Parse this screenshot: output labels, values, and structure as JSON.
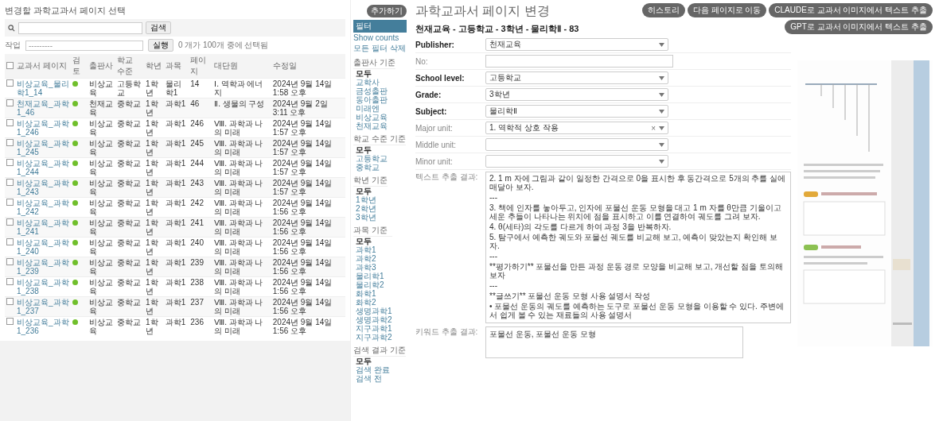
{
  "list_panel": {
    "title": "변경할 과학교과서 페이지 선택",
    "search": {
      "button": "검색"
    },
    "action": {
      "label": "작업",
      "value": "---------",
      "button": "실행",
      "count": "0 개가 100개 중에 선택됨"
    },
    "select_all_checked": false,
    "columns": [
      "교과서 페이지",
      "검토",
      "출판사",
      "학교 수준",
      "학년",
      "과목",
      "페이지",
      "대단원",
      "수정일"
    ],
    "rows": [
      {
        "checked": false,
        "reviewed": true,
        "cells": [
          "비상교육_물리학1_14",
          "",
          "비상교육",
          "고등학교",
          "1학년",
          "물리학1",
          "14",
          "Ⅰ. 역학과 에너지",
          "2024년 9월 14일 1:58 오후"
        ]
      },
      {
        "checked": false,
        "reviewed": true,
        "cells": [
          "천재교육_과학1_46",
          "",
          "천재교육",
          "중학교",
          "1학년",
          "과학1",
          "46",
          "Ⅱ. 생물의 구성",
          "2024년 9월 2일 3:11 오후"
        ]
      },
      {
        "checked": false,
        "reviewed": true,
        "cells": [
          "비상교육_과학1_246",
          "",
          "비상교육",
          "중학교",
          "1학년",
          "과학1",
          "246",
          "Ⅷ. 과학과 나의 미래",
          "2024년 9월 14일 1:57 오후"
        ]
      },
      {
        "checked": false,
        "reviewed": true,
        "cells": [
          "비상교육_과학1_245",
          "",
          "비상교육",
          "중학교",
          "1학년",
          "과학1",
          "245",
          "Ⅷ. 과학과 나의 미래",
          "2024년 9월 14일 1:57 오후"
        ]
      },
      {
        "checked": false,
        "reviewed": true,
        "cells": [
          "비상교육_과학1_244",
          "",
          "비상교육",
          "중학교",
          "1학년",
          "과학1",
          "244",
          "Ⅷ. 과학과 나의 미래",
          "2024년 9월 14일 1:57 오후"
        ]
      },
      {
        "checked": false,
        "reviewed": true,
        "cells": [
          "비상교육_과학1_243",
          "",
          "비상교육",
          "중학교",
          "1학년",
          "과학1",
          "243",
          "Ⅷ. 과학과 나의 미래",
          "2024년 9월 14일 1:57 오후"
        ]
      },
      {
        "checked": false,
        "reviewed": true,
        "cells": [
          "비상교육_과학1_242",
          "",
          "비상교육",
          "중학교",
          "1학년",
          "과학1",
          "242",
          "Ⅷ. 과학과 나의 미래",
          "2024년 9월 14일 1:56 오후"
        ]
      },
      {
        "checked": false,
        "reviewed": true,
        "cells": [
          "비상교육_과학1_241",
          "",
          "비상교육",
          "중학교",
          "1학년",
          "과학1",
          "241",
          "Ⅷ. 과학과 나의 미래",
          "2024년 9월 14일 1:56 오후"
        ]
      },
      {
        "checked": false,
        "reviewed": true,
        "cells": [
          "비상교육_과학1_240",
          "",
          "비상교육",
          "중학교",
          "1학년",
          "과학1",
          "240",
          "Ⅷ. 과학과 나의 미래",
          "2024년 9월 14일 1:56 오후"
        ]
      },
      {
        "checked": false,
        "reviewed": true,
        "cells": [
          "비상교육_과학1_239",
          "",
          "비상교육",
          "중학교",
          "1학년",
          "과학1",
          "239",
          "Ⅷ. 과학과 나의 미래",
          "2024년 9월 14일 1:56 오후"
        ]
      },
      {
        "checked": false,
        "reviewed": true,
        "cells": [
          "비상교육_과학1_238",
          "",
          "비상교육",
          "중학교",
          "1학년",
          "과학1",
          "238",
          "Ⅷ. 과학과 나의 미래",
          "2024년 9월 14일 1:56 오후"
        ]
      },
      {
        "checked": false,
        "reviewed": true,
        "cells": [
          "비상교육_과학1_237",
          "",
          "비상교육",
          "중학교",
          "1학년",
          "과학1",
          "237",
          "Ⅷ. 과학과 나의 미래",
          "2024년 9월 14일 1:56 오후"
        ]
      },
      {
        "checked": false,
        "reviewed": true,
        "cells": [
          "비상교육_과학1_236",
          "",
          "비상교육",
          "중학교",
          "1학년",
          "과학1",
          "236",
          "Ⅷ. 과학과 나의 미래",
          "2024년 9월 14일 1:56 오후"
        ]
      }
    ]
  },
  "add_button": "추가하기",
  "filter": {
    "title": "필터",
    "show_counts": "Show counts",
    "clear": "모든 필터 삭제",
    "sections": [
      {
        "title": "출판사 기준",
        "items": [
          {
            "label": "모두",
            "selected": true
          },
          {
            "label": "교학사",
            "selected": false
          },
          {
            "label": "금성출판",
            "selected": false
          },
          {
            "label": "동아출판",
            "selected": false
          },
          {
            "label": "미래엔",
            "selected": false
          },
          {
            "label": "비상교육",
            "selected": false
          },
          {
            "label": "천재교육",
            "selected": false
          }
        ]
      },
      {
        "title": "학교 수준 기준",
        "items": [
          {
            "label": "모두",
            "selected": true
          },
          {
            "label": "고등학교",
            "selected": false
          },
          {
            "label": "중학교",
            "selected": false
          }
        ]
      },
      {
        "title": "학년 기준",
        "items": [
          {
            "label": "모두",
            "selected": true
          },
          {
            "label": "1학년",
            "selected": false
          },
          {
            "label": "2학년",
            "selected": false
          },
          {
            "label": "3학년",
            "selected": false
          }
        ]
      },
      {
        "title": "과목 기준",
        "items": [
          {
            "label": "모두",
            "selected": true
          },
          {
            "label": "과학1",
            "selected": false
          },
          {
            "label": "과학2",
            "selected": false
          },
          {
            "label": "과학3",
            "selected": false
          },
          {
            "label": "물리학1",
            "selected": false
          },
          {
            "label": "물리학2",
            "selected": false
          },
          {
            "label": "화학1",
            "selected": false
          },
          {
            "label": "화학2",
            "selected": false
          },
          {
            "label": "생명과학1",
            "selected": false
          },
          {
            "label": "생명과학2",
            "selected": false
          },
          {
            "label": "지구과학1",
            "selected": false
          },
          {
            "label": "지구과학2",
            "selected": false
          }
        ]
      },
      {
        "title": "검색 결과 기준",
        "items": [
          {
            "label": "모두",
            "selected": true
          },
          {
            "label": "검색 완료",
            "selected": false
          },
          {
            "label": "검색 전",
            "selected": false
          }
        ]
      }
    ]
  },
  "edit": {
    "title": "과학교과서 페이지 변경",
    "subtitle": "천재교육 - 고등학교 - 3학년 - 물리학Ⅱ - 83",
    "buttons": [
      "히스토리",
      "다음 페이지로 이동",
      "CLAUDE로 교과서 이미지에서 텍스트 추출",
      "GPT로 교과서 이미지에서 텍스트 추출"
    ],
    "fields": [
      {
        "label": "Publisher:",
        "required": true,
        "kind": "select",
        "value": "천재교육"
      },
      {
        "label": "No:",
        "required": false,
        "kind": "input"
      },
      {
        "label": "School level:",
        "required": true,
        "kind": "select",
        "value": "고등학교"
      },
      {
        "label": "Grade:",
        "required": true,
        "kind": "select",
        "value": "3학년"
      },
      {
        "label": "Subject:",
        "required": true,
        "kind": "select",
        "value": "물리학Ⅱ"
      },
      {
        "label": "Major unit:",
        "required": false,
        "kind": "select",
        "value": "1. 역학적 상호 작용",
        "clearable": true,
        "clear_icon": "×"
      },
      {
        "label": "Middle unit:",
        "required": false,
        "kind": "select"
      },
      {
        "label": "Minor unit:",
        "required": false,
        "kind": "select"
      }
    ],
    "text_result": {
      "label": "텍스트 추출 결과:",
      "lines": [
        "2. 1 m 자에 그림과 같이 일정한 간격으로 0을 표시한 후 동간격으로 5개의 추를 실에 매달아 보자.",
        "---",
        "3. 책에 인자를 놓아두고, 인자에 포물선 운동 모형을 대고 1 m 자를 θ만큼 기울이고 세운 추들이 나타나는 위치에 점을 표시하고 이를 연결하여 궤도를 그려 보자.",
        "4. θ(세타)의 각도를 다르게 하여 과정 3을 반복하자.",
        "5. 탐구에서 예측한 궤도와 포물선 궤도를 비교해 보고, 예측이 맞았는지 확인해 보자.",
        "---",
        "**평가하기** 포물선을 만든 과정 운동 경로 모양을 비교해 보고, 개선할 점을 토의해 보자",
        "---",
        "**글쓰기** 포물선 운동 모형 사용 설명서 작성",
        "• 포물선 운동의 궤도를 예측하는 도구로 포물선 운동 모형을 이용할 수 있다. 주변에서 쉽게 볼 수 있는 재료들의 사용 설명서"
      ]
    },
    "keyword_result": {
      "label": "키워드 추출 결과:",
      "value": "포물선 운동, 포물선 운동 모형"
    }
  }
}
